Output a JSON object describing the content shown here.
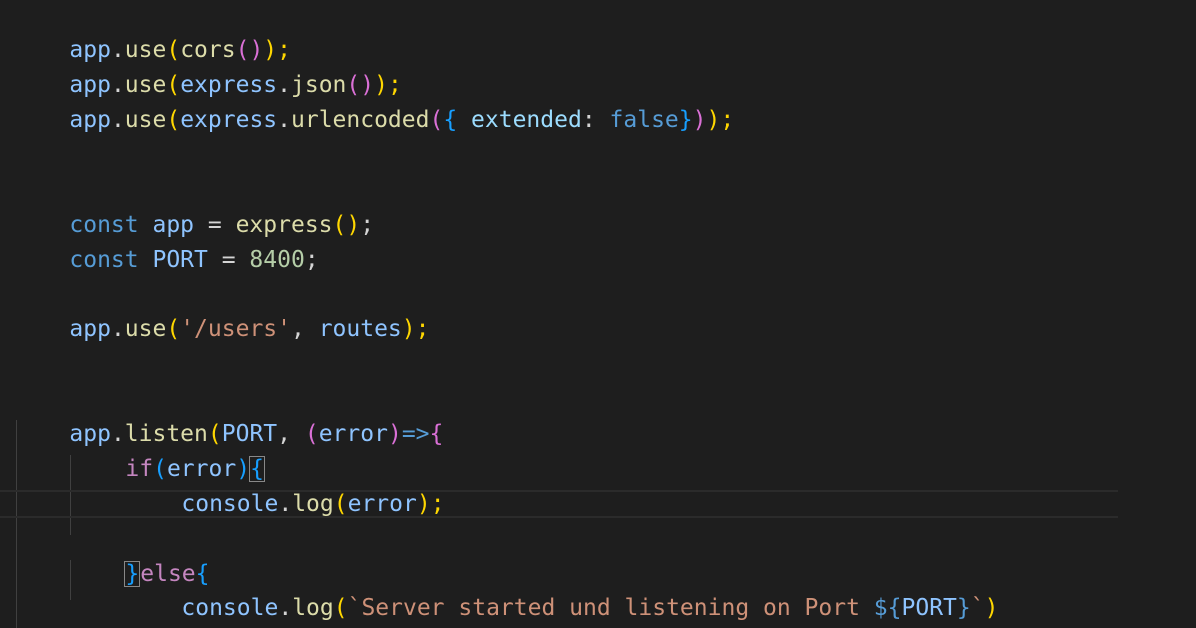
{
  "code": {
    "line1": [
      "app",
      ".",
      "use",
      "(",
      "cors",
      "()",
      ");"
    ],
    "line2": [
      "app",
      ".",
      "use",
      "(",
      "express",
      ".",
      "json",
      "()",
      ");"
    ],
    "line3": [
      "app",
      ".",
      "use",
      "(",
      "express",
      ".",
      "urlencoded",
      "(",
      "{ ",
      "extended",
      ": ",
      "false",
      "}",
      ")",
      ");"
    ],
    "line4": [
      "const ",
      "app",
      " = ",
      "express",
      "()",
      ";"
    ],
    "line5": [
      "const ",
      "PORT",
      " = ",
      "8400",
      ";"
    ],
    "line6": [
      "app",
      ".",
      "use",
      "(",
      "'/users'",
      ", ",
      "routes",
      ");"
    ],
    "line7": [
      "app",
      ".",
      "listen",
      "(",
      "PORT",
      ", ",
      "(",
      "error",
      ")",
      "=>",
      "{"
    ],
    "line8": [
      "if",
      "(",
      "error",
      ")",
      "{"
    ],
    "line9": [
      "console",
      ".",
      "log",
      "(",
      "error",
      ");"
    ],
    "line10": [
      "}",
      "else",
      "{"
    ],
    "line11": [
      "console",
      ".",
      "log",
      "(",
      "`Server started und listening on Port ",
      "${",
      "PORT",
      "}",
      "`",
      ")"
    ],
    "line12": [
      "}"
    ]
  },
  "colors": {
    "background": "#1e1e1e",
    "variable": "#8fc4ff",
    "function": "#dcdcaa",
    "keyword": "#569cd6",
    "string": "#ce9178",
    "number": "#b5cea8"
  }
}
